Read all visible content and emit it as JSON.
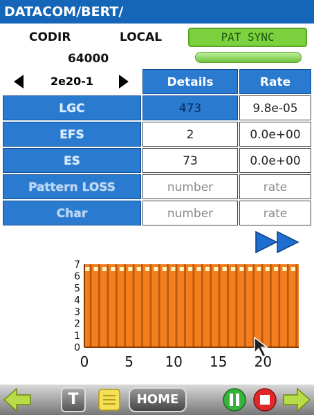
{
  "title": "DATACOM/BERT/",
  "info": {
    "codir": "CODIR",
    "local": "LOCAL",
    "rate_value": "64000",
    "pat_sync": "PAT SYNC"
  },
  "selector": {
    "value": "2e20-1"
  },
  "table": {
    "headers": {
      "details": "Details",
      "rate": "Rate"
    },
    "rows": [
      {
        "label": "LGC",
        "details": "473",
        "rate": "9.8e-05"
      },
      {
        "label": "EFS",
        "details": "2",
        "rate": "0.0e+00"
      },
      {
        "label": "ES",
        "details": "73",
        "rate": "0.0e+00"
      },
      {
        "label": "Pattern LOSS",
        "details": "number",
        "rate": "rate"
      },
      {
        "label": "Char",
        "details": "number",
        "rate": "rate"
      }
    ]
  },
  "chart_data": {
    "type": "bar",
    "x": [
      0,
      1,
      2,
      3,
      4,
      5,
      6,
      7,
      8,
      9,
      10,
      11,
      12,
      13,
      14,
      15,
      15,
      16,
      17,
      18,
      19,
      20,
      21,
      22,
      23
    ],
    "values": [
      7,
      7,
      7,
      7,
      7,
      7,
      7,
      7,
      7,
      7,
      7,
      7,
      7,
      7,
      7,
      7,
      7,
      7,
      7,
      7,
      7,
      7,
      7,
      7,
      7
    ],
    "xticks": [
      "0",
      "5",
      "10",
      "15",
      "20"
    ],
    "yticks": [
      "0",
      "1",
      "2",
      "3",
      "4",
      "5",
      "6",
      "7"
    ],
    "xlim": [
      0,
      24
    ],
    "ylim": [
      0,
      7
    ],
    "colors": {
      "bar": "#f37e1e",
      "edge": "#8a3a00",
      "cap": "#fff4c0"
    }
  },
  "taskbar": {
    "home": "HOME",
    "t": "T"
  }
}
